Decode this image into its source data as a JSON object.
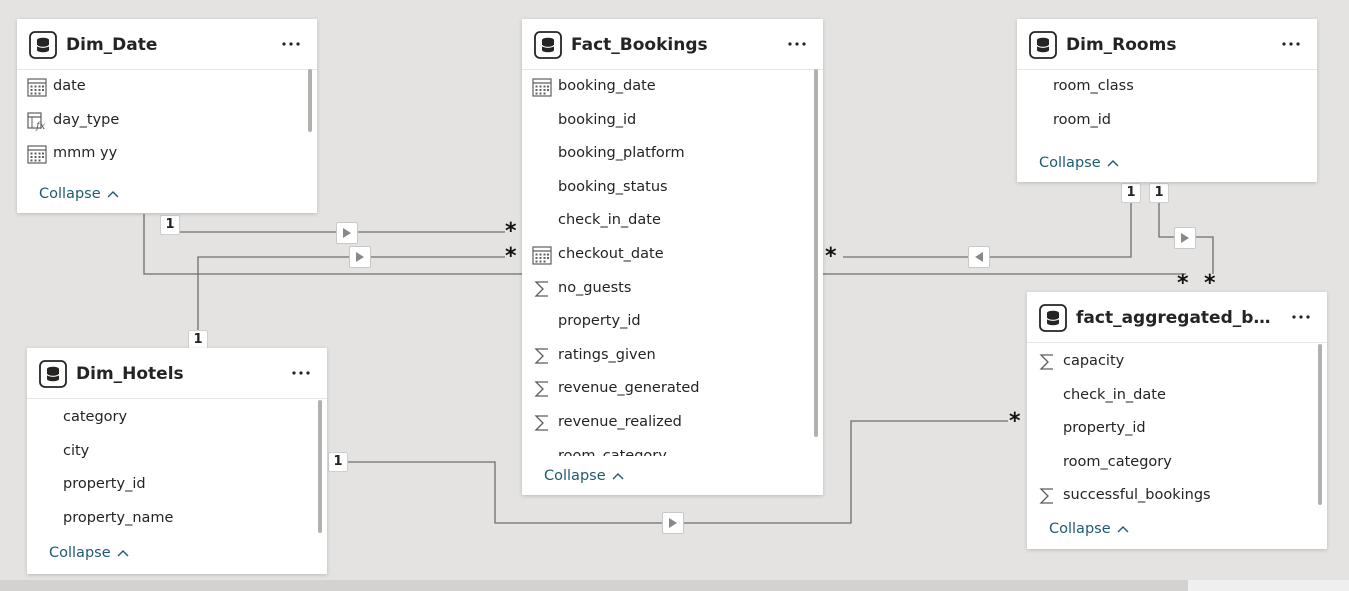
{
  "tables": [
    {
      "id": "dim_date",
      "title": "Dim_Date",
      "collapse_label": "Collapse",
      "fields": [
        {
          "name": "date",
          "icon": "calendar-icon"
        },
        {
          "name": "day_type",
          "icon": "calculated-column-icon"
        },
        {
          "name": "mmm yy",
          "icon": "calendar-icon"
        }
      ]
    },
    {
      "id": "fact_bookings",
      "title": "Fact_Bookings",
      "collapse_label": "Collapse",
      "fields": [
        {
          "name": "booking_date",
          "icon": "calendar-icon"
        },
        {
          "name": "booking_id",
          "icon": ""
        },
        {
          "name": "booking_platform",
          "icon": ""
        },
        {
          "name": "booking_status",
          "icon": ""
        },
        {
          "name": "check_in_date",
          "icon": ""
        },
        {
          "name": "checkout_date",
          "icon": "calendar-icon"
        },
        {
          "name": "no_guests",
          "icon": "sigma-icon"
        },
        {
          "name": "property_id",
          "icon": ""
        },
        {
          "name": "ratings_given",
          "icon": "sigma-icon"
        },
        {
          "name": "revenue_generated",
          "icon": "sigma-icon"
        },
        {
          "name": "revenue_realized",
          "icon": "sigma-icon"
        },
        {
          "name": "room_category",
          "icon": ""
        }
      ]
    },
    {
      "id": "dim_rooms",
      "title": "Dim_Rooms",
      "collapse_label": "Collapse",
      "fields": [
        {
          "name": "room_class",
          "icon": ""
        },
        {
          "name": "room_id",
          "icon": ""
        }
      ]
    },
    {
      "id": "dim_hotels",
      "title": "Dim_Hotels",
      "collapse_label": "Collapse",
      "fields": [
        {
          "name": "category",
          "icon": ""
        },
        {
          "name": "city",
          "icon": ""
        },
        {
          "name": "property_id",
          "icon": ""
        },
        {
          "name": "property_name",
          "icon": ""
        }
      ]
    },
    {
      "id": "fact_aggregated_bookings",
      "title": "fact_aggregated_booki...",
      "collapse_label": "Collapse",
      "fields": [
        {
          "name": "capacity",
          "icon": "sigma-icon"
        },
        {
          "name": "check_in_date",
          "icon": ""
        },
        {
          "name": "property_id",
          "icon": ""
        },
        {
          "name": "room_category",
          "icon": ""
        },
        {
          "name": "successful_bookings",
          "icon": "sigma-icon"
        }
      ]
    }
  ],
  "relationships": [
    {
      "from": "Dim_Date",
      "to": "Fact_Bookings",
      "from_cardinality": "1",
      "to_cardinality": "*",
      "filter_direction": "single"
    },
    {
      "from": "Dim_Date",
      "to": "fact_aggregated_bookings",
      "from_cardinality": "1",
      "to_cardinality": "*",
      "filter_direction": "single"
    },
    {
      "from": "Dim_Hotels",
      "to": "Fact_Bookings",
      "from_cardinality": "1",
      "to_cardinality": "*",
      "filter_direction": "single"
    },
    {
      "from": "Dim_Hotels",
      "to": "fact_aggregated_bookings",
      "from_cardinality": "1",
      "to_cardinality": "*",
      "filter_direction": "single"
    },
    {
      "from": "Dim_Rooms",
      "to": "Fact_Bookings",
      "from_cardinality": "1",
      "to_cardinality": "*",
      "filter_direction": "single"
    },
    {
      "from": "Dim_Rooms",
      "to": "fact_aggregated_bookings",
      "from_cardinality": "1",
      "to_cardinality": "*",
      "filter_direction": "single"
    }
  ],
  "more_menu_glyph": "···",
  "colors": {
    "canvas": "#e4e3e1",
    "link": "#1f5b70",
    "line": "#6e6e6e"
  }
}
